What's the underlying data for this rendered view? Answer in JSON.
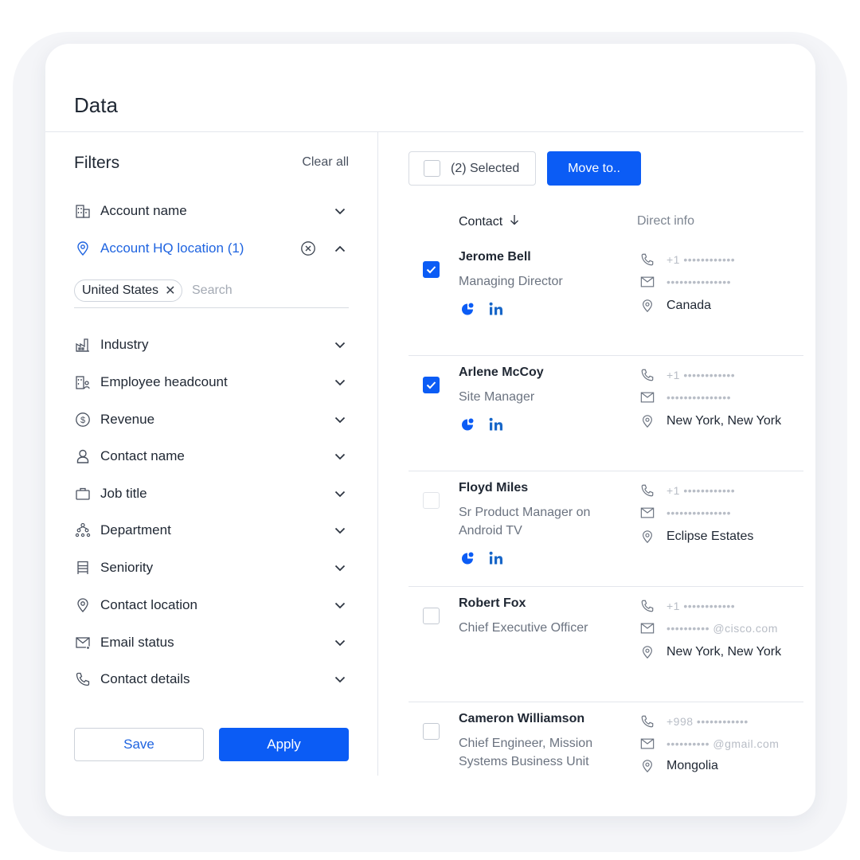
{
  "page": {
    "title": "Data"
  },
  "filters": {
    "title": "Filters",
    "clear_all": "Clear all",
    "items": [
      {
        "label": "Account name",
        "icon": "building-icon"
      },
      {
        "label": "Account HQ location (1)",
        "icon": "map-pin-icon",
        "active": true
      },
      {
        "label": "Industry",
        "icon": "factory-icon"
      },
      {
        "label": "Employee headcount",
        "icon": "building-people-icon"
      },
      {
        "label": "Revenue",
        "icon": "dollar-circle-icon"
      },
      {
        "label": "Contact name",
        "icon": "person-icon"
      },
      {
        "label": "Job title",
        "icon": "briefcase-icon"
      },
      {
        "label": "Department",
        "icon": "org-chart-icon"
      },
      {
        "label": "Seniority",
        "icon": "ladder-icon"
      },
      {
        "label": "Contact location",
        "icon": "map-pin-icon"
      },
      {
        "label": "Email status",
        "icon": "email-status-icon"
      },
      {
        "label": "Contact details",
        "icon": "phone-icon"
      }
    ],
    "location_chip": "United States",
    "location_search_placeholder": "Search",
    "save_label": "Save",
    "apply_label": "Apply"
  },
  "toolbar": {
    "selected_label": "(2) Selected",
    "move_label": "Move to.."
  },
  "columns": {
    "contact": "Contact",
    "direct_info": "Direct info"
  },
  "contacts": [
    {
      "name": "Jerome Bell",
      "title": "Managing Director",
      "checked": true,
      "social": true,
      "phone": "+1 ••••••••••••",
      "email": "•••••••••••••••",
      "location": "Canada"
    },
    {
      "name": "Arlene McCoy",
      "title": "Site Manager",
      "checked": true,
      "social": true,
      "phone": "+1 ••••••••••••",
      "email": "•••••••••••••••",
      "location": "New York, New York"
    },
    {
      "name": "Floyd Miles",
      "title": "Sr Product Manager on Android TV",
      "checked": false,
      "social": true,
      "phone": "+1 ••••••••••••",
      "email": "•••••••••••••••",
      "location": "Eclipse Estates"
    },
    {
      "name": "Robert Fox",
      "title": "Chief Executive Officer",
      "checked": false,
      "social": false,
      "phone": "+1 ••••••••••••",
      "email": "•••••••••• @cisco.com",
      "location": "New York, New York"
    },
    {
      "name": "Cameron Williamson",
      "title": "Chief Engineer, Mission Systems Business Unit",
      "checked": false,
      "social": false,
      "phone": "+998 ••••••••••••",
      "email": "•••••••••• @gmail.com",
      "location": "Mongolia"
    }
  ],
  "colors": {
    "accent": "#0b5cf5",
    "link": "#1f64e0",
    "text": "#1f2733",
    "muted": "#6b7380"
  }
}
